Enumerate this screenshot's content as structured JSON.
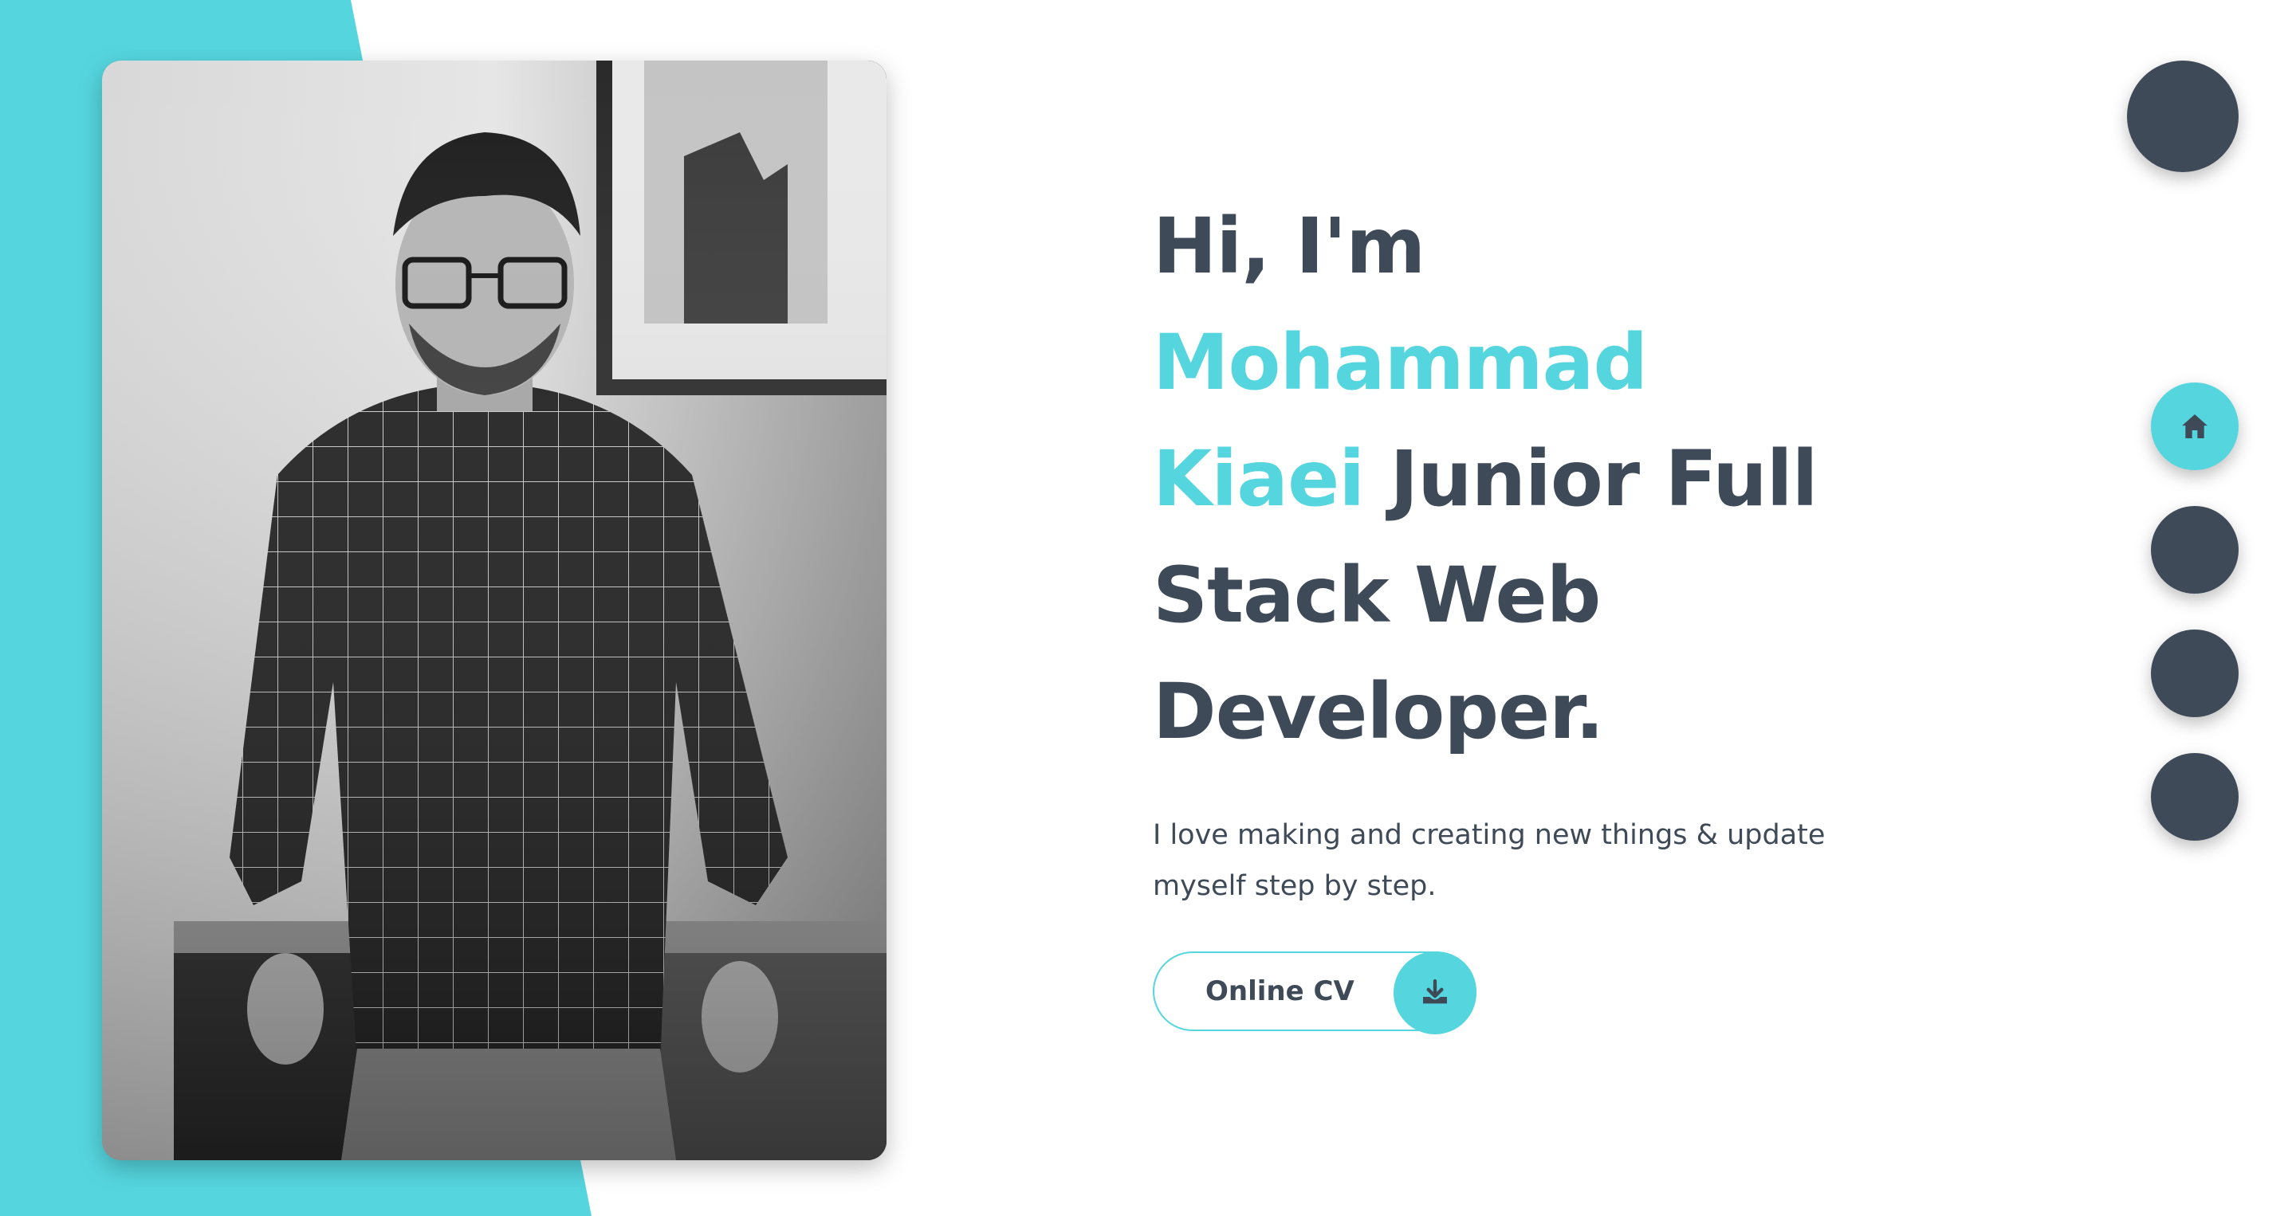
{
  "colors": {
    "accent": "#55d6df",
    "dark": "#3f4a58",
    "background": "#ffffff"
  },
  "hero": {
    "greeting": "Hi, I'm",
    "name": "Mohammad Kiaei",
    "role": "Junior Full Stack Web Developer.",
    "tagline": "I love making and creating new things & update myself step by step.",
    "cv_button": {
      "label": "Online CV",
      "icon": "download-icon"
    }
  },
  "photo": {
    "icon": "profile-photo"
  },
  "theme_toggle": {
    "icon": "theme-toggle"
  },
  "side_nav": {
    "items": [
      {
        "icon": "home-icon",
        "active": true
      },
      {
        "icon": "nav-item",
        "active": false
      },
      {
        "icon": "nav-item",
        "active": false
      },
      {
        "icon": "nav-item",
        "active": false
      }
    ]
  }
}
